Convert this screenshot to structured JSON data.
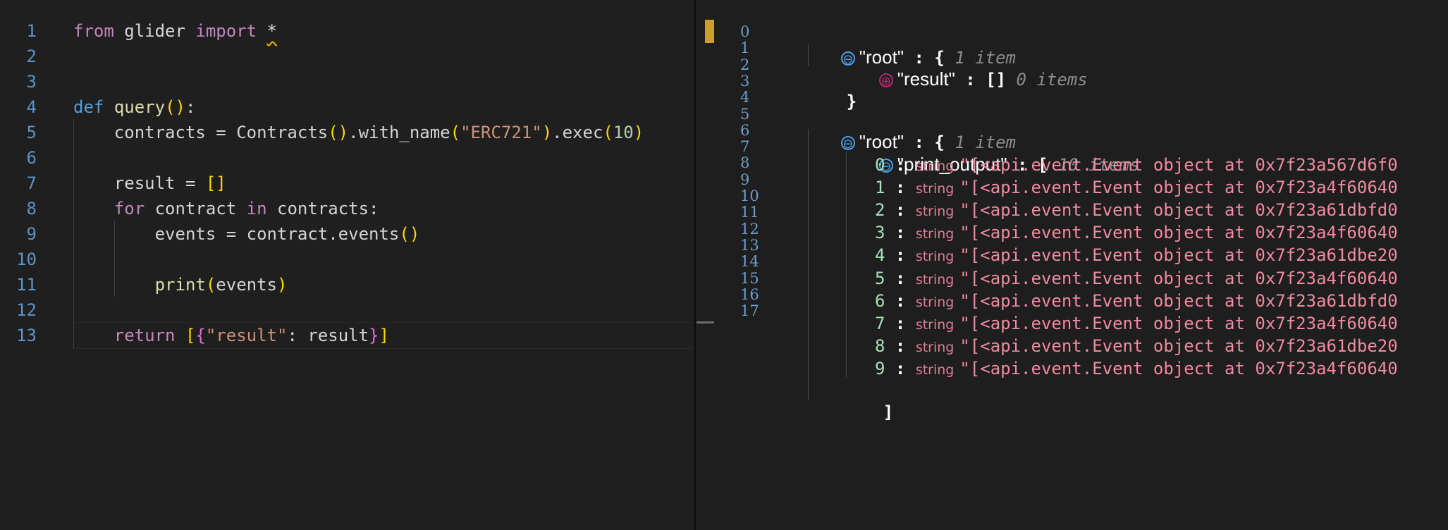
{
  "editor": {
    "lines": [
      {
        "num": "1",
        "tokens": [
          {
            "t": "from",
            "c": "kw-purple"
          },
          {
            "t": " glider ",
            "c": "plain"
          },
          {
            "t": "import",
            "c": "kw-purple"
          },
          {
            "t": " ",
            "c": "plain"
          },
          {
            "t": "*",
            "c": "plain squiggle"
          }
        ]
      },
      {
        "num": "2",
        "tokens": []
      },
      {
        "num": "3",
        "tokens": []
      },
      {
        "num": "4",
        "tokens": [
          {
            "t": "def",
            "c": "kw-blue"
          },
          {
            "t": " ",
            "c": "plain"
          },
          {
            "t": "query",
            "c": "fn"
          },
          {
            "t": "()",
            "c": "brk-y"
          },
          {
            "t": ":",
            "c": "plain"
          }
        ]
      },
      {
        "num": "5",
        "tokens": [
          {
            "t": "    contracts = Contracts",
            "c": "plain"
          },
          {
            "t": "()",
            "c": "brk-y"
          },
          {
            "t": ".with_name",
            "c": "plain"
          },
          {
            "t": "(",
            "c": "brk-y"
          },
          {
            "t": "\"ERC721\"",
            "c": "str"
          },
          {
            "t": ")",
            "c": "brk-y"
          },
          {
            "t": ".exec",
            "c": "plain"
          },
          {
            "t": "(",
            "c": "brk-y"
          },
          {
            "t": "10",
            "c": "num"
          },
          {
            "t": ")",
            "c": "brk-y"
          }
        ]
      },
      {
        "num": "6",
        "tokens": []
      },
      {
        "num": "7",
        "tokens": [
          {
            "t": "    result = ",
            "c": "plain"
          },
          {
            "t": "[]",
            "c": "brk-y"
          }
        ]
      },
      {
        "num": "8",
        "tokens": [
          {
            "t": "    ",
            "c": "plain"
          },
          {
            "t": "for",
            "c": "kw-purple"
          },
          {
            "t": " contract ",
            "c": "plain"
          },
          {
            "t": "in",
            "c": "kw-purple"
          },
          {
            "t": " contracts:",
            "c": "plain"
          }
        ]
      },
      {
        "num": "9",
        "tokens": [
          {
            "t": "        events = contract.events",
            "c": "plain"
          },
          {
            "t": "()",
            "c": "brk-y"
          }
        ]
      },
      {
        "num": "10",
        "tokens": []
      },
      {
        "num": "11",
        "tokens": [
          {
            "t": "        ",
            "c": "plain"
          },
          {
            "t": "print",
            "c": "fn"
          },
          {
            "t": "(",
            "c": "brk-y"
          },
          {
            "t": "events",
            "c": "plain"
          },
          {
            "t": ")",
            "c": "brk-y"
          }
        ]
      },
      {
        "num": "12",
        "tokens": []
      },
      {
        "num": "13",
        "tokens": [
          {
            "t": "    ",
            "c": "plain"
          },
          {
            "t": "return",
            "c": "kw-purple"
          },
          {
            "t": " ",
            "c": "plain"
          },
          {
            "t": "[",
            "c": "brk-y"
          },
          {
            "t": "{",
            "c": "brk-p"
          },
          {
            "t": "\"result\"",
            "c": "str"
          },
          {
            "t": ": result",
            "c": "plain"
          },
          {
            "t": "}",
            "c": "brk-p"
          },
          {
            "t": "]",
            "c": "brk-y"
          }
        ]
      }
    ]
  },
  "viewer": {
    "line_numbers": [
      "0",
      "1",
      "2",
      "3",
      "4",
      "5",
      "6",
      "7",
      "8",
      "9",
      "10",
      "11",
      "12",
      "13",
      "14",
      "15",
      "16",
      "17"
    ],
    "block1": {
      "root_key": "\"root\"",
      "root_sep": " : {",
      "root_count": "1 item",
      "result_key": "\"result\"",
      "result_sep": " : []",
      "result_count": "0 items",
      "close": "}"
    },
    "block2": {
      "root_key": "\"root\"",
      "root_sep": " : {",
      "root_count": "1 item",
      "print_key": "\"print_output\"",
      "print_sep": " : [",
      "print_count": "10 items",
      "close": "]",
      "type_label": "string",
      "items": [
        {
          "index": "0",
          "value": "\"[<api.event.Event object at 0x7f23a567d6f0"
        },
        {
          "index": "1",
          "value": "\"[<api.event.Event object at 0x7f23a4f60640"
        },
        {
          "index": "2",
          "value": "\"[<api.event.Event object at 0x7f23a61dbfd0"
        },
        {
          "index": "3",
          "value": "\"[<api.event.Event object at 0x7f23a4f60640"
        },
        {
          "index": "4",
          "value": "\"[<api.event.Event object at 0x7f23a61dbe20"
        },
        {
          "index": "5",
          "value": "\"[<api.event.Event object at 0x7f23a4f60640"
        },
        {
          "index": "6",
          "value": "\"[<api.event.Event object at 0x7f23a61dbfd0"
        },
        {
          "index": "7",
          "value": "\"[<api.event.Event object at 0x7f23a4f60640"
        },
        {
          "index": "8",
          "value": "\"[<api.event.Event object at 0x7f23a61dbe20"
        },
        {
          "index": "9",
          "value": "\"[<api.event.Event object at 0x7f23a4f60640"
        }
      ]
    }
  },
  "icons": {
    "collapse": "⊖",
    "expand": "⊕"
  }
}
